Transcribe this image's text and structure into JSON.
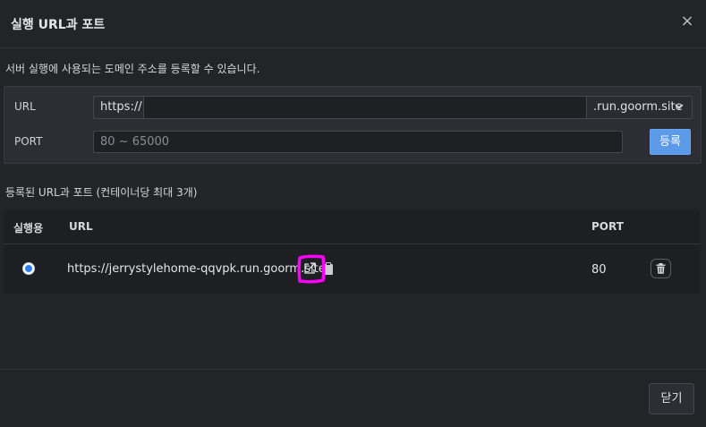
{
  "dialog": {
    "title": "실행 URL과 포트",
    "close_glyph": "×",
    "description": "서버 실행에 사용되는 도메인 주소를 등록할 수 있습니다."
  },
  "form": {
    "url_label": "URL",
    "url_prefix": "https://",
    "url_value": "",
    "domain_suffix": ".run.goorm.site",
    "port_label": "PORT",
    "port_placeholder": "80 ~ 65000",
    "register_label": "등록"
  },
  "registered": {
    "title": "등록된 URL과 포트 (컨테이너당 최대 3개)",
    "columns": {
      "run": "실행용",
      "url": "URL",
      "port": "PORT"
    },
    "rows": [
      {
        "selected": true,
        "url": "https://jerrystylehome-qqvpk.run.goorm.site",
        "port": "80"
      }
    ]
  },
  "footer": {
    "close_label": "닫기"
  },
  "icons": [
    "close-icon",
    "chevron-down-icon",
    "external-link-icon",
    "clipboard-icon",
    "trash-icon"
  ],
  "colors": {
    "accent": "#5b9ae8",
    "radio": "#2d7ff0",
    "highlight": "#ff00ff"
  }
}
